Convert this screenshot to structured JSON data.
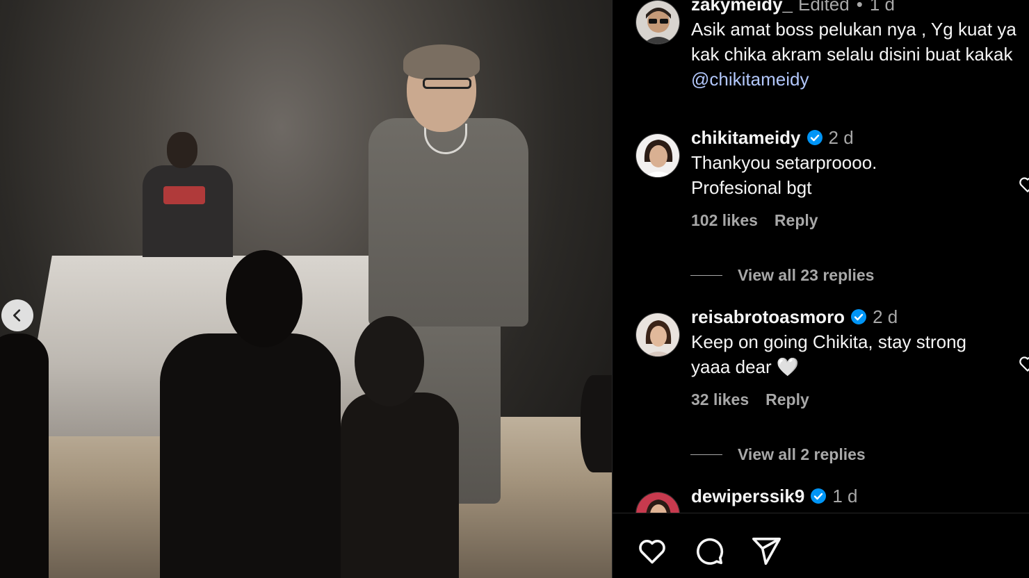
{
  "post": {
    "media_alt": "Concert stage video frame"
  },
  "comments": [
    {
      "username": "zakymeidy_",
      "edited": "Edited",
      "dot": "•",
      "time": "1 d",
      "text": "Asik amat boss pelukan nya , Yg kuat ya kak chika akram selalu disini buat kakak",
      "mention": "@chikitameidy",
      "verified": false
    },
    {
      "username": "chikitameidy",
      "time": "2 d",
      "text_line1": "Thankyou setarproooo.",
      "text_line2": "Profesional bgt",
      "likes": "102 likes",
      "reply": "Reply",
      "view_replies": "View all 23 replies",
      "verified": true
    },
    {
      "username": "reisabrotoasmoro",
      "time": "2 d",
      "text_line1": "Keep on going Chikita, stay strong",
      "text_line2": "yaaa dear 🤍",
      "likes": "32 likes",
      "reply": "Reply",
      "view_replies": "View all 2 replies",
      "verified": true
    },
    {
      "username": "dewiperssik9",
      "time": "1 d",
      "verified": true
    }
  ],
  "colors": {
    "background": "#000000",
    "text": "#f5f5f5",
    "secondary": "#a8a8a8",
    "mention": "#b2c7fb",
    "verified": "#0095f6"
  },
  "icons": {
    "like": "heart-icon",
    "comment": "comment-bubble-icon",
    "share": "send-icon",
    "carousel_prev": "chevron-left-icon"
  }
}
